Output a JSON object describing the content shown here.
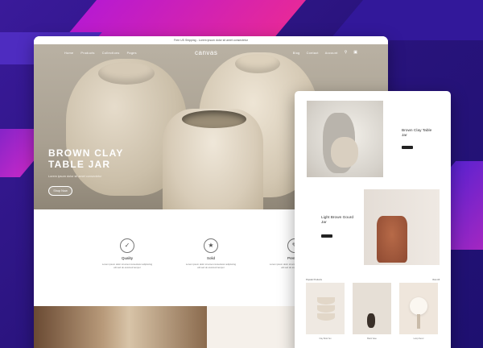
{
  "banner": {
    "announcement": "Free US Shipping - Lorem ipsum dolor sit amet consectetur"
  },
  "nav": {
    "links": [
      "Home",
      "Products",
      "Collections",
      "Pages"
    ],
    "logo": "canvas",
    "right_links": [
      "Blog",
      "Contact",
      "Account"
    ],
    "icons": [
      "search-icon",
      "cart-icon"
    ]
  },
  "hero": {
    "title": "BROWN CLAY TABLE JAR",
    "subtitle": "Lorem ipsum dolor sit amet consectetur",
    "button": "Shop Now"
  },
  "features": [
    {
      "icon": "check-badge-icon",
      "title": "Quality",
      "text": "Lorem ipsum dolor sit amet consectetur adipiscing elit sed do eiusmod tempor"
    },
    {
      "icon": "medal-icon",
      "title": "Solid",
      "text": "Lorem ipsum dolor sit amet consectetur adipiscing elit sed do eiusmod tempor"
    },
    {
      "icon": "certificate-icon",
      "title": "Premium",
      "text": "Lorem ipsum dolor sit amet consectetur adipiscing elit sed do eiusmod tempor"
    }
  ],
  "side": {
    "product1": {
      "title": "Brown Clay Table Jar"
    },
    "product2": {
      "title": "Light Brown Gourd Jar"
    },
    "section_title": "Popular Products",
    "section_more": "View All",
    "minis": [
      "Clay Bowl Set",
      "Black Vase",
      "Lamp Decor"
    ]
  },
  "colors": {
    "bg": "#2a1478",
    "accent_pink": "#e6289a",
    "accent_violet": "#6a22c8",
    "btn_dark": "#222222"
  }
}
